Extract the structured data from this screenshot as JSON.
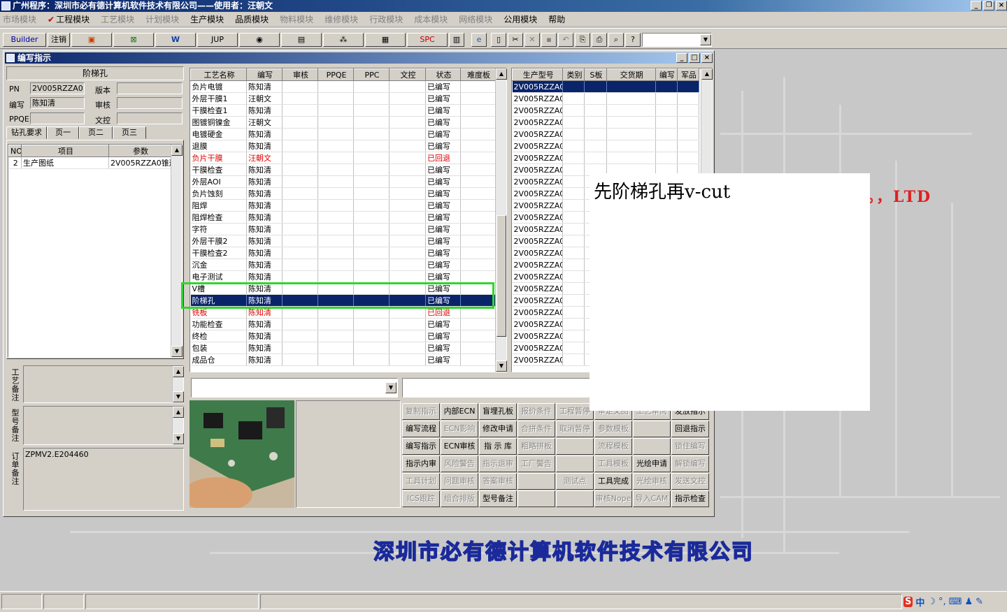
{
  "window": {
    "title": "广州程序：深圳市必有德计算机软件技术有限公司——使用者：汪朝文"
  },
  "menu": [
    {
      "label": "市场模块",
      "enabled": false
    },
    {
      "label": "工程模块",
      "enabled": true,
      "checked": true
    },
    {
      "label": "工艺模块",
      "enabled": false
    },
    {
      "label": "计划模块",
      "enabled": false
    },
    {
      "label": "生产模块",
      "enabled": true
    },
    {
      "label": "品质模块",
      "enabled": true
    },
    {
      "label": "物料模块",
      "enabled": false
    },
    {
      "label": "维修模块",
      "enabled": false
    },
    {
      "label": "行政模块",
      "enabled": false
    },
    {
      "label": "成本模块",
      "enabled": false
    },
    {
      "label": "网络模块",
      "enabled": false
    },
    {
      "label": "公用模块",
      "enabled": true
    },
    {
      "label": "帮助",
      "enabled": true
    }
  ],
  "toolbar": {
    "builder": "Builder",
    "logout": "注销",
    "jup": "JUP",
    "spc": "SPC"
  },
  "child": {
    "title": "编写指示"
  },
  "left": {
    "section_title": "阶梯孔",
    "pn_label": "PN",
    "pn_value": "2V005RZZA0",
    "version_label": "版本",
    "version_value": "",
    "writer_label": "编写",
    "writer_value": "陈知清",
    "review_label": "审核",
    "review_value": "",
    "ppqe_label": "PPQE",
    "ppqe_value": "",
    "doc_label": "文控",
    "doc_value": "",
    "tabs": [
      "钻孔要求",
      "页一",
      "页二",
      "页三"
    ],
    "grid_headers": [
      "NO",
      "项目",
      "参数"
    ],
    "grid_rows": [
      {
        "no": "2",
        "item": "生产图纸",
        "param": "2V005RZZA0锥形"
      }
    ],
    "note1_label": "工艺备注",
    "note2_label": "型号备注",
    "note3_label": "订单备注",
    "note3_value": "ZPMV2.E204460"
  },
  "process": {
    "headers": [
      "工艺名称",
      "编写",
      "审核",
      "PPQE",
      "PPC",
      "文控",
      "状态",
      "难度板"
    ],
    "rows": [
      {
        "name": "负片电镀",
        "writer": "陈知清",
        "status": "已编写"
      },
      {
        "name": "外层干膜1",
        "writer": "汪朝文",
        "status": "已编写"
      },
      {
        "name": "干膜检查1",
        "writer": "陈知清",
        "status": "已编写"
      },
      {
        "name": "图镀铜镍金",
        "writer": "汪朝文",
        "status": "已编写"
      },
      {
        "name": "电镀硬金",
        "writer": "陈知清",
        "status": "已编写"
      },
      {
        "name": "退膜",
        "writer": "陈知清",
        "status": "已编写"
      },
      {
        "name": "负片干膜",
        "writer": "汪朝文",
        "status": "已回退",
        "red": true
      },
      {
        "name": "干膜检查",
        "writer": "陈知清",
        "status": "已编写"
      },
      {
        "name": "外层AOI",
        "writer": "陈知清",
        "status": "已编写"
      },
      {
        "name": "负片蚀刻",
        "writer": "陈知清",
        "status": "已编写"
      },
      {
        "name": "阻焊",
        "writer": "陈知清",
        "status": "已编写"
      },
      {
        "name": "阻焊检查",
        "writer": "陈知清",
        "status": "已编写"
      },
      {
        "name": "字符",
        "writer": "陈知清",
        "status": "已编写"
      },
      {
        "name": "外层干膜2",
        "writer": "陈知清",
        "status": "已编写"
      },
      {
        "name": "干膜检查2",
        "writer": "陈知清",
        "status": "已编写"
      },
      {
        "name": "沉金",
        "writer": "陈知清",
        "status": "已编写"
      },
      {
        "name": "电子测试",
        "writer": "陈知清",
        "status": "已编写"
      },
      {
        "name": "V槽",
        "writer": "陈知清",
        "status": "已编写"
      },
      {
        "name": "阶梯孔",
        "writer": "陈知清",
        "status": "已编写",
        "selected": true
      },
      {
        "name": "铣板",
        "writer": "陈知清",
        "status": "已回退",
        "red": true
      },
      {
        "name": "功能检查",
        "writer": "陈知清",
        "status": "已编写"
      },
      {
        "name": "终检",
        "writer": "陈知清",
        "status": "已编写"
      },
      {
        "name": "包装",
        "writer": "陈知清",
        "status": "已编写"
      },
      {
        "name": "成品仓",
        "writer": "陈知清",
        "status": "已编写"
      }
    ]
  },
  "models": {
    "headers": [
      "生产型号",
      "类别",
      "S板",
      "交货期",
      "编写",
      "军品"
    ],
    "rows": [
      "2V005RZZA0",
      "2V005RZZA0",
      "2V005RZZA0",
      "2V005RZZA0",
      "2V005RZZA0",
      "2V005RZZA0",
      "2V005RZZA0",
      "2V005RZZA0",
      "2V005RZZA0",
      "2V005RZZA0",
      "2V005RZZA0",
      "2V005RZZA0",
      "2V005RZZA0",
      "2V005RZZA0",
      "2V005RZZA0",
      "2V005RZZA0",
      "2V005RZZA0",
      "2V005RZZA0",
      "2V005RZZA0",
      "2V005RZZA0",
      "2V005RZZA0",
      "2V005RZZA0",
      "2V005RZZA0",
      "2V005RZZA0"
    ]
  },
  "actions": [
    {
      "label": "复制指示",
      "enabled": false
    },
    {
      "label": "内部ECN",
      "enabled": true
    },
    {
      "label": "盲埋孔板",
      "enabled": true
    },
    {
      "label": "报价条件",
      "enabled": false
    },
    {
      "label": "工程暂停",
      "enabled": false
    },
    {
      "label": "审定文图",
      "enabled": false
    },
    {
      "label": "工艺审阅",
      "enabled": false
    },
    {
      "label": "发放指示",
      "enabled": true
    },
    {
      "label": "编写流程",
      "enabled": true
    },
    {
      "label": "ECN影响",
      "enabled": false
    },
    {
      "label": "修改申请",
      "enabled": true
    },
    {
      "label": "合拼条件",
      "enabled": false
    },
    {
      "label": "取消暂停",
      "enabled": false
    },
    {
      "label": "参数模板",
      "enabled": false
    },
    {
      "label": "",
      "enabled": false
    },
    {
      "label": "回退指示",
      "enabled": true
    },
    {
      "label": "编写指示",
      "enabled": true
    },
    {
      "label": "ECN审核",
      "enabled": true
    },
    {
      "label": "指 示 库",
      "enabled": true
    },
    {
      "label": "粗略拼板",
      "enabled": false
    },
    {
      "label": "",
      "enabled": false
    },
    {
      "label": "流程模板",
      "enabled": false
    },
    {
      "label": "",
      "enabled": false
    },
    {
      "label": "锁住编写",
      "enabled": false
    },
    {
      "label": "指示内审",
      "enabled": true
    },
    {
      "label": "风险警告",
      "enabled": false
    },
    {
      "label": "指示退审",
      "enabled": false
    },
    {
      "label": "工厂警告",
      "enabled": false
    },
    {
      "label": "",
      "enabled": false
    },
    {
      "label": "工具模板",
      "enabled": false
    },
    {
      "label": "光绘申请",
      "enabled": true
    },
    {
      "label": "解锁编写",
      "enabled": false
    },
    {
      "label": "工具计划",
      "enabled": false
    },
    {
      "label": "问题审核",
      "enabled": false
    },
    {
      "label": "答案审核",
      "enabled": false
    },
    {
      "label": "",
      "enabled": false
    },
    {
      "label": "测试点",
      "enabled": false
    },
    {
      "label": "工具完成",
      "enabled": true
    },
    {
      "label": "光绘审核",
      "enabled": false
    },
    {
      "label": "发送文控",
      "enabled": false
    },
    {
      "label": "ICS跟踪",
      "enabled": false
    },
    {
      "label": "组合排版",
      "enabled": false
    },
    {
      "label": "型号备注",
      "enabled": true
    },
    {
      "label": "",
      "enabled": false
    },
    {
      "label": "",
      "enabled": false
    },
    {
      "label": "审核Nope",
      "enabled": false
    },
    {
      "label": "导入CAM",
      "enabled": false
    },
    {
      "label": "指示检查",
      "enabled": true
    }
  ],
  "desktop": {
    "company_banner": "深圳市必有德计算机软件技术有限公司",
    "ltd_text": "。，LTD"
  },
  "popup": {
    "text": "先阶梯孔再v-cut"
  },
  "tray": {
    "ime": "中"
  }
}
